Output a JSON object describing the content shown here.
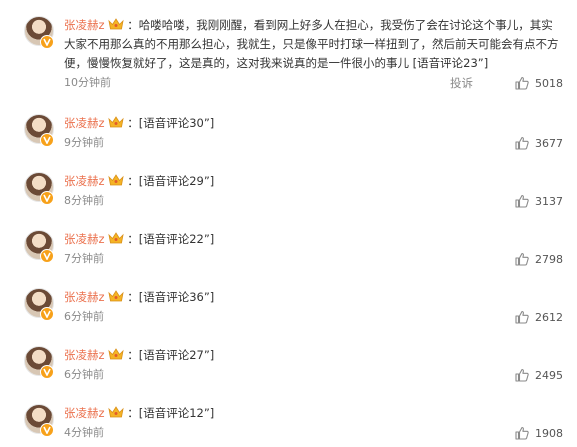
{
  "comments": [
    {
      "user": "张凌赫z",
      "text": "哈喽哈喽，我刚刚醒，看到网上好多人在担心，我受伤了会在讨论这个事儿，其实大家不用那么真的不用那么担心，我就生，只是像平时打球一样扭到了，然后前天可能会有点不方便，慢慢恢复就好了，这是真的，这对我来说真的是一件很小的事儿 [语音评论23”]",
      "time": "10分钟前",
      "report": "投诉",
      "likes": "5018"
    },
    {
      "user": "张凌赫z",
      "text": "[语音评论30”]",
      "time": "9分钟前",
      "likes": "3677"
    },
    {
      "user": "张凌赫z",
      "text": "[语音评论29”]",
      "time": "8分钟前",
      "likes": "3137"
    },
    {
      "user": "张凌赫z",
      "text": "[语音评论22”]",
      "time": "7分钟前",
      "likes": "2798"
    },
    {
      "user": "张凌赫z",
      "text": "[语音评论36”]",
      "time": "6分钟前",
      "likes": "2612"
    },
    {
      "user": "张凌赫z",
      "text": "[语音评论27”]",
      "time": "6分钟前",
      "likes": "2495"
    },
    {
      "user": "张凌赫z",
      "text": "[语音评论12”]",
      "time": "4分钟前",
      "likes": "1908"
    }
  ],
  "colors": {
    "username": "#eb7350",
    "badge": "#f7a11a",
    "meta": "#8a8a8a"
  },
  "icons": {
    "verified": "verified-badge-icon",
    "crown": "crown-icon",
    "like": "thumbs-up-icon"
  }
}
